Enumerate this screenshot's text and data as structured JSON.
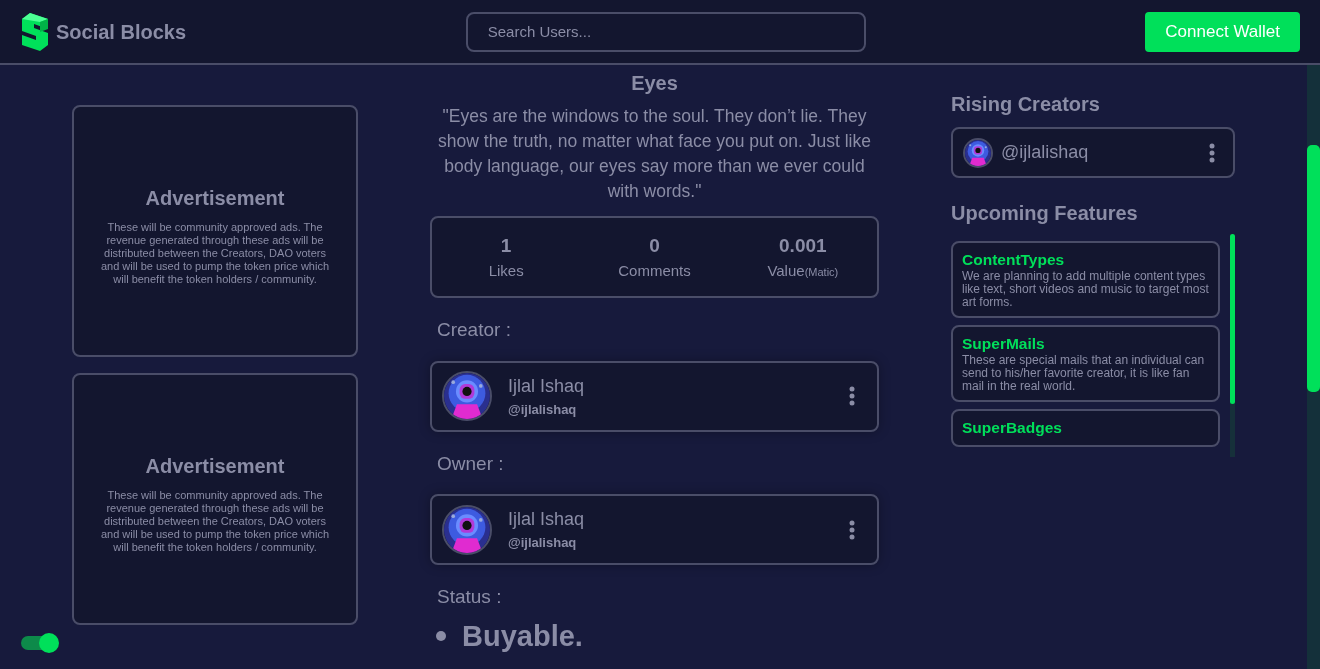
{
  "brand": {
    "name": "Social Blocks"
  },
  "search": {
    "placeholder": "Search Users..."
  },
  "connect_button": {
    "label": "Connect Wallet"
  },
  "ads": [
    {
      "title": "Advertisement",
      "text": "These will be community approved ads. The revenue generated through these ads will be distributed between the Creators, DAO voters and will be used to pump the token price which will benefit the token holders / community."
    },
    {
      "title": "Advertisement",
      "text": "These will be community approved ads. The revenue generated through these ads will be distributed between the Creators, DAO voters and will be used to pump the token price which will benefit the token holders / community."
    }
  ],
  "theme_toggle": {
    "on": true
  },
  "post": {
    "title": "Eyes",
    "quote": "\"Eyes are the windows to the soul. They don’t lie. They show the truth, no matter what face you put on. Just like body language, our eyes say more than we ever could with words.\"",
    "stats": [
      {
        "value": "1",
        "label": "Likes"
      },
      {
        "value": "0",
        "label": "Comments"
      },
      {
        "value": "0.001",
        "label": "Value",
        "unit": "(Matic)"
      }
    ],
    "people": [
      {
        "heading": "Creator :",
        "name": "Ijlal Ishaq",
        "handle": "@ijlalishaq"
      },
      {
        "heading": "Owner :",
        "name": "Ijlal Ishaq",
        "handle": "@ijlalishaq"
      }
    ],
    "status": {
      "heading": "Status :",
      "value": "Buyable."
    }
  },
  "rising_creators": {
    "title": "Rising Creators",
    "items": [
      {
        "handle": "@ijlalishaq"
      }
    ]
  },
  "upcoming_features": {
    "title": "Upcoming Features",
    "items": [
      {
        "title": "ContentTypes",
        "text": "We are planning to add multiple content types like text, short videos and music to target most art forms."
      },
      {
        "title": "SuperMails",
        "text": "These are special mails that an individual can send to his/her favorite creator, it is like fan mail in the real world."
      },
      {
        "title": "SuperBadges"
      }
    ]
  }
}
